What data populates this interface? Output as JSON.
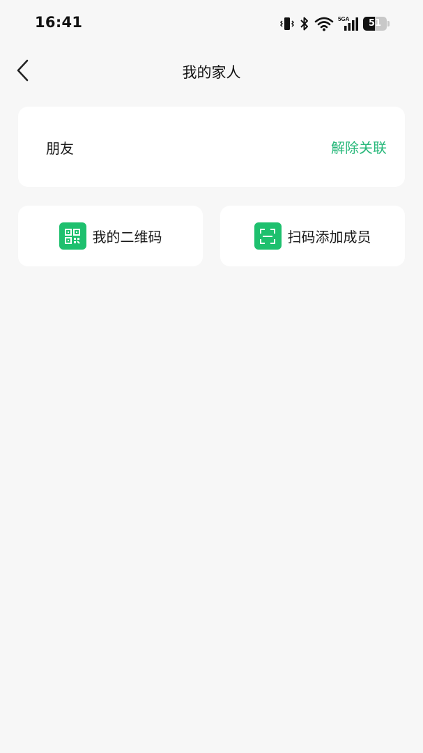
{
  "status_bar": {
    "time": "16:41",
    "network_label": "5GA",
    "battery_level": "51",
    "battery_fraction": 0.51
  },
  "header": {
    "title": "我的家人",
    "back_icon": "chevron-left-icon"
  },
  "members": [
    {
      "name": "朋友",
      "action_label": "解除关联"
    }
  ],
  "actions": [
    {
      "label": "我的二维码",
      "icon": "qr-code-icon"
    },
    {
      "label": "扫码添加成员",
      "icon": "scan-icon"
    }
  ],
  "colors": {
    "accent_text": "#27b87a",
    "icon_bg": "#1ec06e",
    "page_bg": "#f7f7f7",
    "card_bg": "#ffffff"
  }
}
